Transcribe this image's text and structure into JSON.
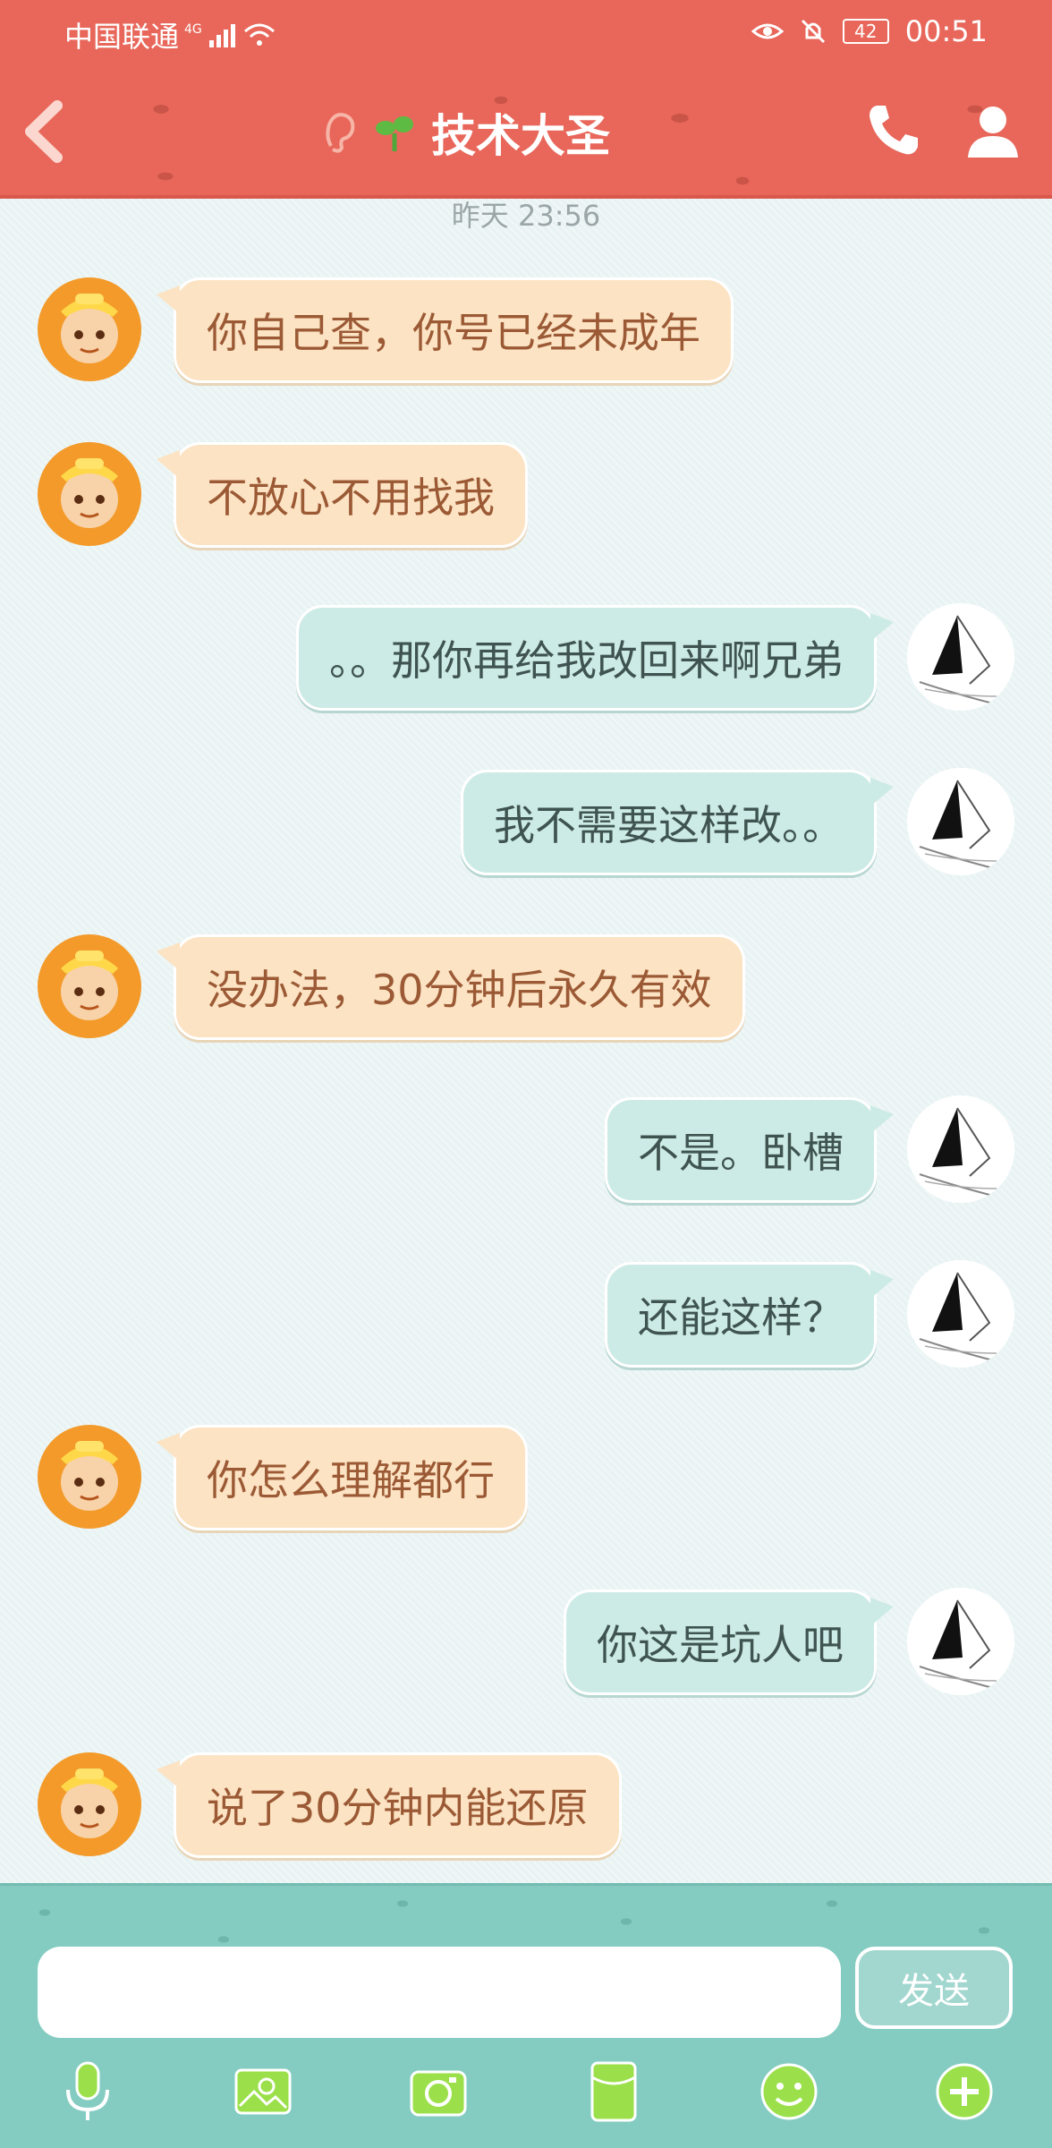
{
  "status_bar": {
    "carrier": "中国联通",
    "network": "4G",
    "battery": "42",
    "time": "00:51"
  },
  "header": {
    "title": "技术大圣"
  },
  "chat": {
    "timestamp": "昨天 23:56",
    "messages": [
      {
        "side": "left",
        "text": "你自己查，你号已经未成年"
      },
      {
        "side": "left",
        "text": "不放心不用找我"
      },
      {
        "side": "right",
        "text": "。。那你再给我改回来啊兄弟"
      },
      {
        "side": "right",
        "text": "我不需要这样改。。"
      },
      {
        "side": "left",
        "text": "没办法，30分钟后永久有效"
      },
      {
        "side": "right",
        "text": "不是。卧槽"
      },
      {
        "side": "right",
        "text": "还能这样？"
      },
      {
        "side": "left",
        "text": "你怎么理解都行"
      },
      {
        "side": "right",
        "text": "你这是坑人吧"
      },
      {
        "side": "left",
        "text": "说了30分钟内能还原"
      }
    ]
  },
  "input_bar": {
    "placeholder": "",
    "send_label": "发送",
    "tools": [
      "microphone-icon",
      "photo-icon",
      "camera-icon",
      "red-packet-icon",
      "emoji-icon",
      "plus-icon"
    ]
  },
  "colors": {
    "header": "#e8675a",
    "left_bubble": "#fce3c3",
    "right_bubble": "#cdebe6",
    "input_bar": "#84ccc1"
  }
}
